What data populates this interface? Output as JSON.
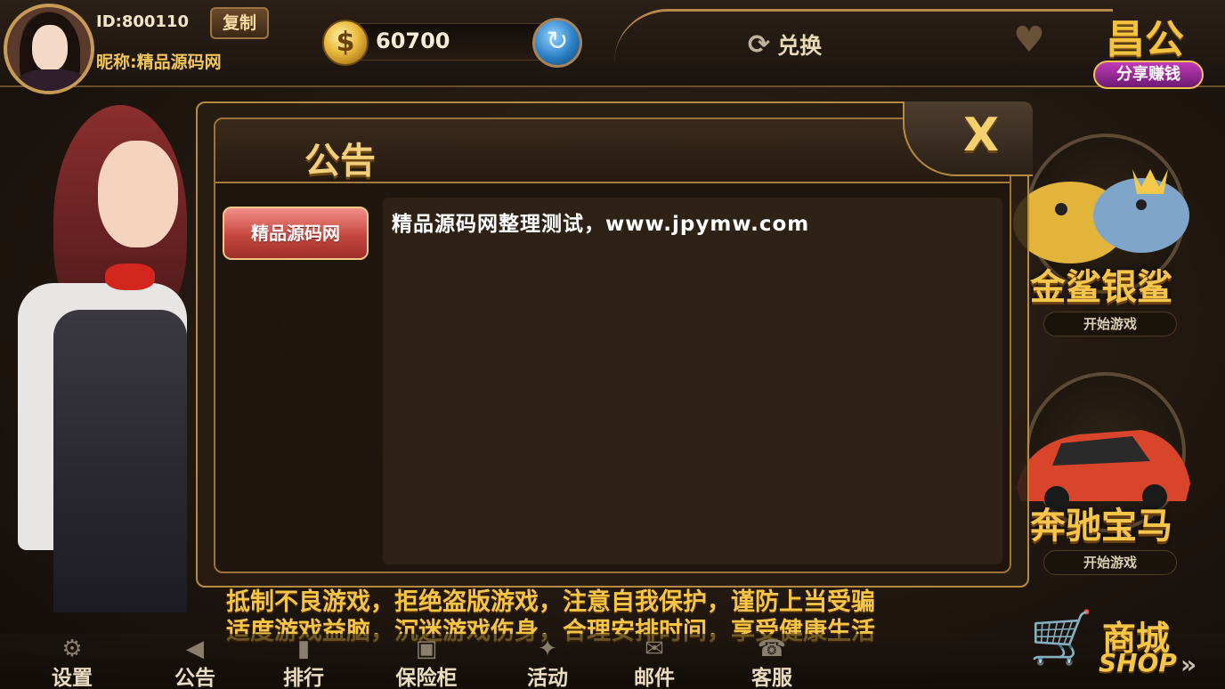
{
  "profile": {
    "id_label": "ID:800110",
    "copy_label": "复制",
    "nickname": "昵称:精品源码网"
  },
  "wallet": {
    "coin_symbol": "$",
    "coins": "60700",
    "refresh_symbol": "↻"
  },
  "exchange": {
    "icon_symbol": "⟳",
    "label": "兑换"
  },
  "share": {
    "big_text": "昌公",
    "tag": "分享赚钱"
  },
  "games": [
    {
      "name": "金鲨银鲨",
      "start": "开始游戏"
    },
    {
      "name": "奔驰宝马",
      "start": "开始游戏"
    }
  ],
  "announcement": {
    "title": "公告",
    "close_label": "X",
    "tabs": [
      {
        "label": "精品源码网",
        "active": true
      }
    ],
    "content": "精品源码网整理测试，www.jpymw.com"
  },
  "warning": {
    "line1": "抵制不良游戏，拒绝盗版游戏，注意自我保护，谨防上当受骗",
    "line2": "适度游戏益脑，沉迷游戏伤身，合理安排时间，享受健康生活"
  },
  "nav": [
    {
      "label": "设置",
      "icon": "⚙"
    },
    {
      "label": "公告",
      "icon": "◀"
    },
    {
      "label": "排行",
      "icon": "▮"
    },
    {
      "label": "保险柜",
      "icon": "▣"
    },
    {
      "label": "活动",
      "icon": "✦"
    },
    {
      "label": "邮件",
      "icon": "✉"
    },
    {
      "label": "客服",
      "icon": "☎"
    }
  ],
  "shop": {
    "cn": "商城",
    "en": "SHOP",
    "arrows": "»"
  },
  "colors": {
    "gold": "#f6c646",
    "tab_red": "#c54840",
    "modal_border": "#b88a3e"
  }
}
